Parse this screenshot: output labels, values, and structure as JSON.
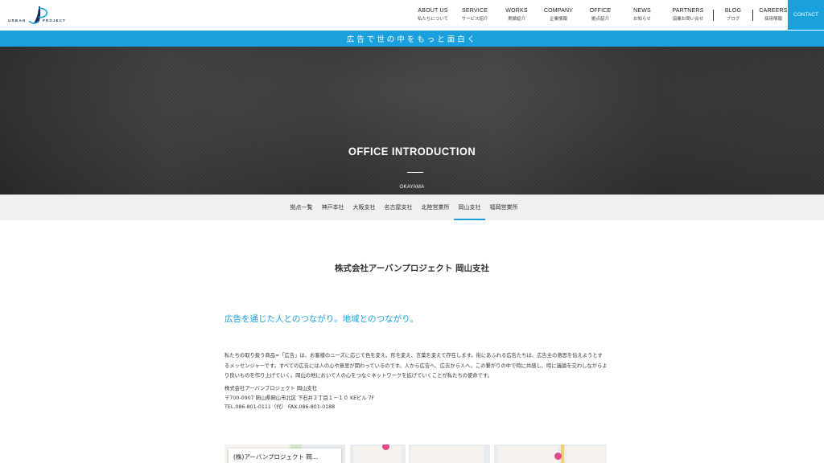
{
  "header": {
    "logo_text": "URBAN PROJECT",
    "nav": [
      {
        "en": "ABOUT US",
        "ja": "私たちについて"
      },
      {
        "en": "SERVICE",
        "ja": "サービス紹介"
      },
      {
        "en": "WORKS",
        "ja": "実績紹介"
      },
      {
        "en": "COMPANY",
        "ja": "企業情報"
      },
      {
        "en": "OFFICE",
        "ja": "拠点紹介"
      },
      {
        "en": "NEWS",
        "ja": "お知らせ"
      },
      {
        "en": "PARTNERS",
        "ja": "協業お問い合せ"
      },
      {
        "en": "BLOG",
        "ja": "ブログ"
      },
      {
        "en": "CAREERS",
        "ja": "採用情報"
      }
    ],
    "contact_label": "CONTACT"
  },
  "tagline": "広告で世の中をもっと面白く",
  "hero": {
    "title": "OFFICE INTRODUCTION",
    "subtitle": "OKAYAMA"
  },
  "office_tabs": [
    "拠点一覧",
    "神戸本社",
    "大阪支社",
    "名古屋支社",
    "北陸営業所",
    "岡山支社",
    "福岡営業所"
  ],
  "active_tab": "岡山支社",
  "content": {
    "company_name": "株式会社アーバンプロジェクト 岡山支社",
    "catchphrase": "広告を通じた人とのつながり。地域とのつながり。",
    "body": "私たちの取り扱う商品=「広告」は、お客様のニーズに応じて色を変え、形を変え、言葉を変えて存在します。街にあふれる広告たちは、広告主の意思を伝えようとするメッセンジャーです。すべての広告には人の心や意思が関わっているのです。人から広告へ、広告から人へ。この繋がりの中で時に共感し、時に議論を交わしながらより良いものを作り上げていく。岡山の地において人の心をつなぐネットワークを拡げていくことが私たちの使命です。",
    "address": {
      "name": "株式会社アーバンプロジェクト 岡山支社",
      "postal": "〒700-0907 岡山県岡山市北区 下石井２丁目１－１０ KEビル 7F",
      "tel": "TEL.086-801-0111（代） FAX.086-801-0188"
    }
  },
  "map": {
    "card_label": "(株)アーバンプロジェクト 岡..."
  },
  "colors": {
    "accent": "#1aa0dc",
    "tab_bar_bg": "#f0f0f0"
  }
}
